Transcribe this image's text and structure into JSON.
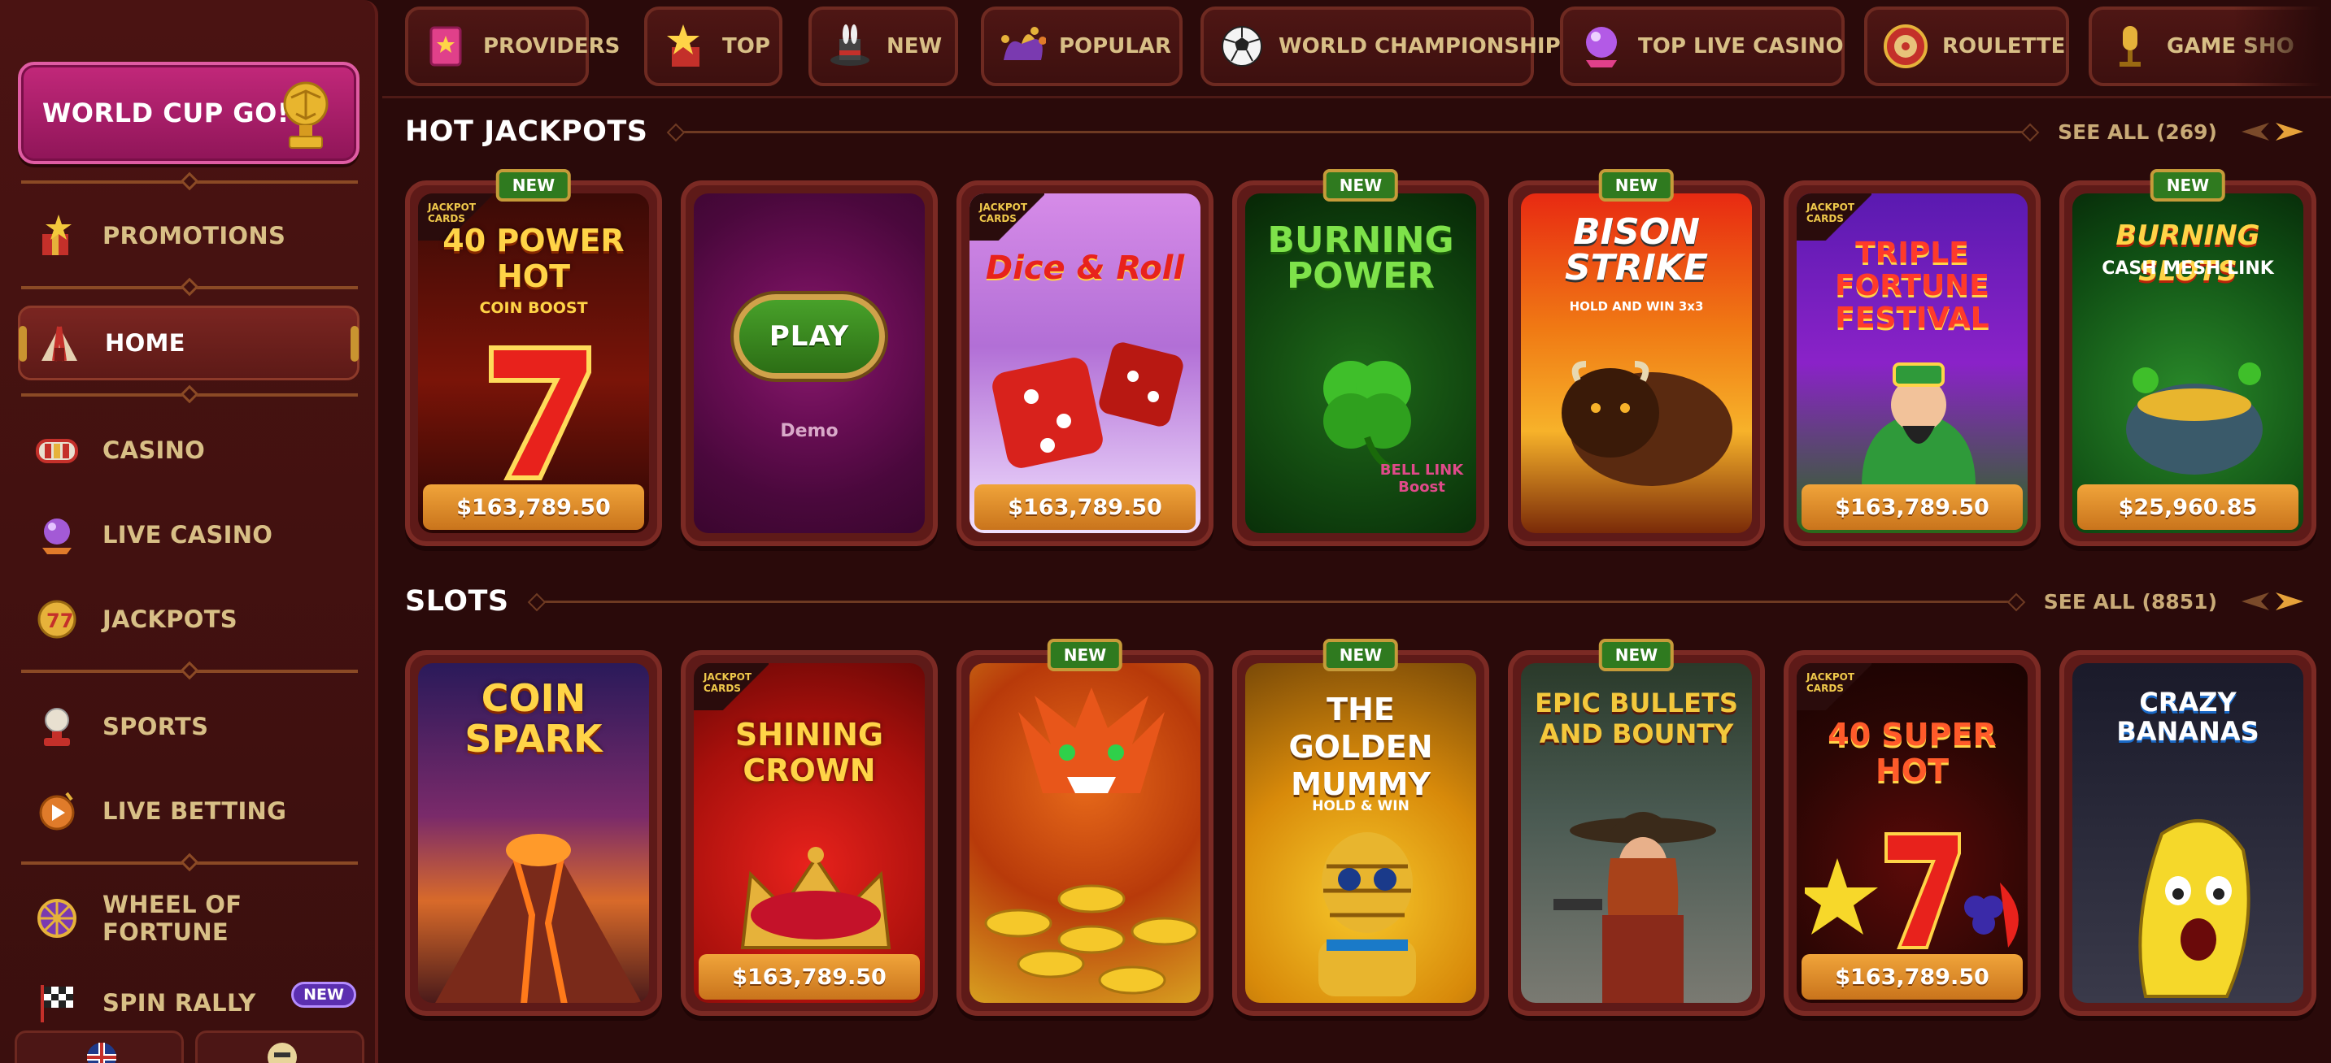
{
  "sidebar": {
    "cta_label": "WORLD CUP GO!",
    "items": [
      {
        "label": "PROMOTIONS"
      },
      {
        "label": "HOME"
      },
      {
        "label": "CASINO"
      },
      {
        "label": "LIVE CASINO"
      },
      {
        "label": "JACKPOTS"
      },
      {
        "label": "SPORTS"
      },
      {
        "label": "LIVE BETTING"
      },
      {
        "label": "WHEEL OF FORTUNE"
      },
      {
        "label": "SPIN RALLY",
        "badge": "NEW"
      }
    ]
  },
  "categories": [
    {
      "label": "PROVIDERS",
      "icon": "book-icon"
    },
    {
      "label": "TOP",
      "icon": "star-box-icon"
    },
    {
      "label": "NEW",
      "icon": "magic-hat-icon"
    },
    {
      "label": "POPULAR",
      "icon": "jester-hat-icon"
    },
    {
      "label": "WORLD CHAMPIONSHIP",
      "icon": "soccer-ball-icon"
    },
    {
      "label": "TOP LIVE CASINO",
      "icon": "crystal-ball-icon"
    },
    {
      "label": "ROULETTE",
      "icon": "roulette-icon"
    },
    {
      "label": "GAME SHO",
      "icon": "mic-icon"
    }
  ],
  "jackpots": {
    "title": "HOT JACKPOTS",
    "see_all": "SEE ALL (269)",
    "cards": [
      {
        "title": "40 POWER HOT",
        "sub": "COIN BOOST",
        "tag": "JACKPOT CARDS",
        "new": "NEW",
        "prize": "$163,789.50"
      },
      {
        "play": "PLAY",
        "demo": "Demo"
      },
      {
        "title": "Dice & Roll",
        "tag": "JACKPOT CARDS",
        "prize": "$163,789.50"
      },
      {
        "title": "BURNING POWER",
        "new": "NEW",
        "sub": "BELL LINK Boost"
      },
      {
        "title": "BISON STRIKE",
        "sub": "HOLD AND WIN 3x3",
        "new": "NEW"
      },
      {
        "title": "TRIPLE FORTUNE FESTIVAL",
        "tag": "JACKPOT CARDS",
        "prize": "$163,789.50"
      },
      {
        "title": "BURNING SLOTS",
        "sub": "CASH MESH LINK",
        "new": "NEW",
        "prize": "$25,960.85"
      }
    ]
  },
  "slots": {
    "title": "SLOTS",
    "see_all": "SEE ALL (8851)",
    "cards": [
      {
        "title": "COIN SPARK"
      },
      {
        "title": "SHINING CROWN",
        "tag": "JACKPOT CARDS",
        "prize": "$163,789.50"
      },
      {
        "title": "",
        "new": "NEW"
      },
      {
        "title": "THE GOLDEN MUMMY",
        "sub": "HOLD & WIN",
        "new": "NEW"
      },
      {
        "title": "EPIC BULLETS AND BOUNTY",
        "new": "NEW"
      },
      {
        "title": "40 SUPER HOT",
        "tag": "JACKPOT CARDS",
        "prize": "$163,789.50"
      },
      {
        "title": "CRAZY BANANAS"
      }
    ]
  }
}
